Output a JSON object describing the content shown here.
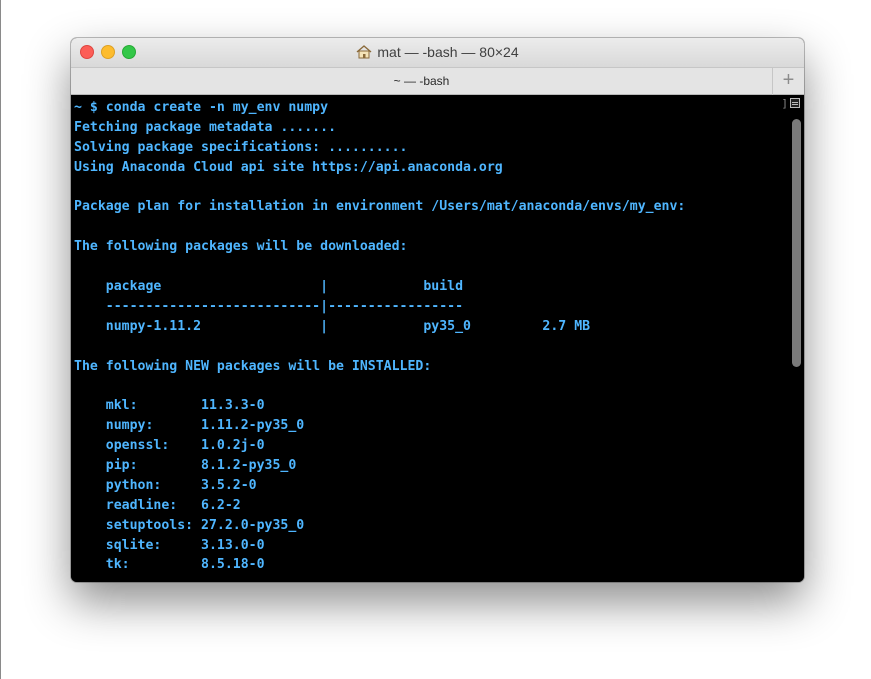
{
  "window": {
    "title": "mat — -bash — 80×24",
    "tab_label": "~ — -bash",
    "add_tab": "+"
  },
  "colors": {
    "terminal_bg": "#000000",
    "terminal_text": "#4fb6ff",
    "close": "#fc5e57",
    "minimize": "#fdbc2e",
    "zoom": "#33c748"
  },
  "terminal": {
    "lines": [
      "~ $ conda create -n my_env numpy",
      "Fetching package metadata .......",
      "Solving package specifications: ..........",
      "Using Anaconda Cloud api site https://api.anaconda.org",
      "",
      "Package plan for installation in environment /Users/mat/anaconda/envs/my_env:",
      "",
      "The following packages will be downloaded:",
      "",
      "    package                    |            build",
      "    ---------------------------|-----------------",
      "    numpy-1.11.2               |            py35_0         2.7 MB",
      "",
      "The following NEW packages will be INSTALLED:",
      "",
      "    mkl:        11.3.3-0",
      "    numpy:      1.11.2-py35_0",
      "    openssl:    1.0.2j-0",
      "    pip:        8.1.2-py35_0",
      "    python:     3.5.2-0",
      "    readline:   6.2-2",
      "    setuptools: 27.2.0-py35_0",
      "    sqlite:     3.13.0-0",
      "    tk:         8.5.18-0"
    ]
  }
}
